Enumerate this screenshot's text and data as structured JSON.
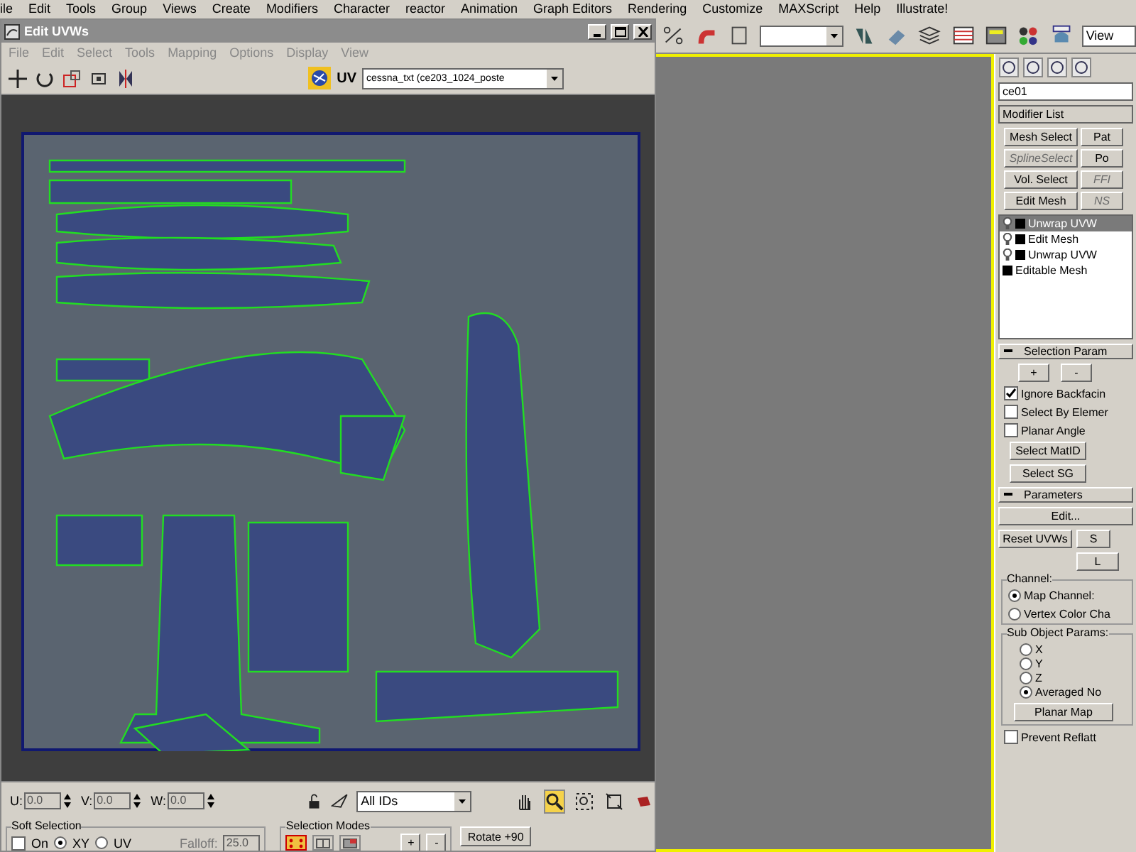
{
  "menu_bar": [
    "ile",
    "Edit",
    "Tools",
    "Group",
    "Views",
    "Create",
    "Modifiers",
    "Character",
    "reactor",
    "Animation",
    "Graph Editors",
    "Rendering",
    "Customize",
    "MAXScript",
    "Help",
    "Illustrate!"
  ],
  "main_toolbar": {
    "view_dropdown": "View"
  },
  "command_panel": {
    "object_name": "ce01",
    "modifier_list": "Modifier List",
    "modifier_buttons": [
      {
        "label": "Mesh Select",
        "disabled": false
      },
      {
        "label": "Pat",
        "disabled": false
      },
      {
        "label": "SplineSelect",
        "disabled": true
      },
      {
        "label": "Po",
        "disabled": false
      },
      {
        "label": "Vol. Select",
        "disabled": false
      },
      {
        "label": "FFI",
        "disabled": true
      },
      {
        "label": "Edit Mesh",
        "disabled": false
      },
      {
        "label": "NS",
        "disabled": true
      }
    ],
    "stack": [
      {
        "label": "Unwrap UVW",
        "kind": "modifier",
        "selected": true
      },
      {
        "label": "Edit Mesh",
        "kind": "modifier",
        "selected": false
      },
      {
        "label": "Unwrap UVW",
        "kind": "modifier",
        "selected": false
      },
      {
        "label": "Editable Mesh",
        "kind": "base",
        "selected": false
      }
    ],
    "selection_rollout": {
      "title": "Selection Param",
      "buttons": [
        "+",
        "-"
      ],
      "options": [
        {
          "label": "Ignore Backfacin",
          "checked": true
        },
        {
          "label": "Select By Elemer",
          "checked": false
        },
        {
          "label": "Planar Angle",
          "checked": false
        }
      ],
      "select_buttons": [
        "Select MatID",
        "Select SG"
      ]
    },
    "parameters_rollout": {
      "title": "Parameters",
      "edit_button": "Edit...",
      "row_buttons": [
        "Reset UVWs",
        "S"
      ],
      "small_button": "L",
      "channel": {
        "title": "Channel:",
        "options": [
          {
            "label": "Map Channel:",
            "selected": true
          },
          {
            "label": "Vertex Color Cha",
            "selected": false
          }
        ]
      },
      "sub_object": {
        "title": "Sub Object Params:",
        "options": [
          {
            "label": "X",
            "selected": false
          },
          {
            "label": "Y",
            "selected": false
          },
          {
            "label": "Z",
            "selected": false
          },
          {
            "label": "Averaged No",
            "selected": true
          }
        ]
      },
      "planar_button": "Planar Map",
      "prevent": {
        "label": "Prevent Reflatt",
        "checked": false
      }
    }
  },
  "uvw_window": {
    "title": "Edit UVWs",
    "menu": [
      "File",
      "Edit",
      "Select",
      "Tools",
      "Mapping",
      "Options",
      "Display",
      "View"
    ],
    "map_label": "UV",
    "map_dropdown": "cessna_txt (ce203_1024_poste",
    "coords": [
      {
        "label": "U:",
        "value": "0.0"
      },
      {
        "label": "V:",
        "value": "0.0"
      },
      {
        "label": "W:",
        "value": "0.0"
      }
    ],
    "id_dropdown": "All IDs",
    "nav_tools": [
      {
        "kind": "pan",
        "selected": false
      },
      {
        "kind": "zoom",
        "selected": true
      },
      {
        "kind": "zoom_region",
        "selected": false
      },
      {
        "kind": "zoom_extents",
        "selected": false
      },
      {
        "kind": "filter",
        "selected": false
      }
    ],
    "soft_selection": {
      "title": "Soft Selection",
      "on": {
        "label": "On",
        "checked": false
      },
      "modes": [
        {
          "label": "XY",
          "selected": true
        },
        {
          "label": "UV",
          "selected": false
        }
      ],
      "falloff_label": "Falloff:",
      "falloff": "25.0"
    },
    "selection_modes": {
      "title": "Selection Modes",
      "modes": [
        {
          "kind": "vertex",
          "selected": true
        },
        {
          "kind": "edge",
          "selected": false
        },
        {
          "kind": "face",
          "selected": false
        }
      ],
      "buttons": [
        "+",
        "-"
      ]
    },
    "rotate_button": "Rotate +90"
  }
}
